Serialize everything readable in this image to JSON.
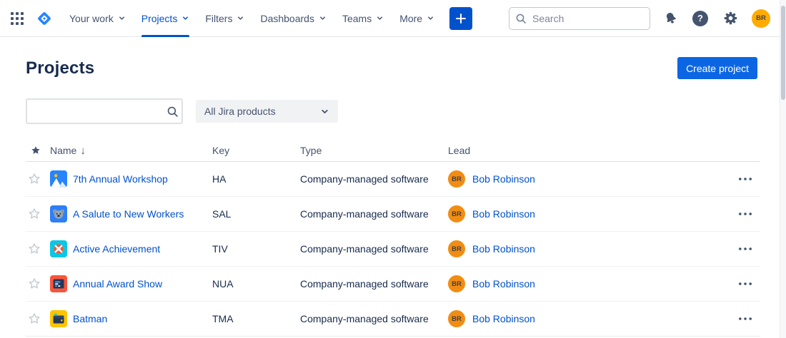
{
  "nav": {
    "items": [
      "Your work",
      "Projects",
      "Filters",
      "Dashboards",
      "Teams",
      "More"
    ],
    "active_item": "Projects",
    "search": {
      "placeholder": "Search",
      "value": ""
    },
    "avatar_initials": "BR"
  },
  "page": {
    "title": "Projects",
    "create_button_label": "Create project"
  },
  "filters": {
    "search_value": "",
    "product_filter_value": "All Jira products"
  },
  "table": {
    "columns": {
      "name": "Name",
      "key": "Key",
      "type": "Type",
      "lead": "Lead"
    },
    "sort": {
      "column": "Name",
      "direction": "descending",
      "indicator": "↓"
    },
    "rows": [
      {
        "name": "7th Annual Workshop",
        "key": "HA",
        "type": "Company-managed software",
        "lead": "Bob Robinson",
        "lead_initials": "BR",
        "icon": "mountains-sun-icon"
      },
      {
        "name": "A Salute to New Workers",
        "key": "SAL",
        "type": "Company-managed software",
        "lead": "Bob Robinson",
        "lead_initials": "BR",
        "icon": "koala-icon"
      },
      {
        "name": "Active Achievement",
        "key": "TIV",
        "type": "Company-managed software",
        "lead": "Bob Robinson",
        "lead_initials": "BR",
        "icon": "lifebuoy-icon"
      },
      {
        "name": "Annual Award Show",
        "key": "NUA",
        "type": "Company-managed software",
        "lead": "Bob Robinson",
        "lead_initials": "BR",
        "icon": "list-panel-icon"
      },
      {
        "name": "Batman",
        "key": "TMA",
        "type": "Company-managed software",
        "lead": "Bob Robinson",
        "lead_initials": "BR",
        "icon": "wallet-icon"
      }
    ]
  },
  "colors": {
    "accent_blue": "#0052CC",
    "create_button_blue": "#0C66E4",
    "link_blue": "#0052CC",
    "nav_text": "#44546F",
    "heading_text": "#172B4D",
    "lead_avatar_orange": "#F18D13",
    "user_avatar_orange": "#FFAB00"
  }
}
